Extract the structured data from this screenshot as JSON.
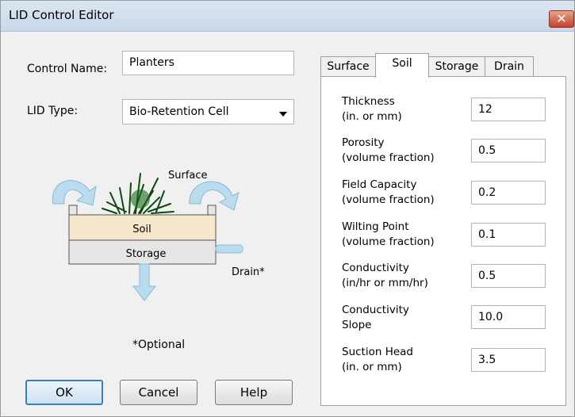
{
  "window": {
    "title": "LID Control Editor",
    "close_glyph": "✕"
  },
  "form": {
    "control_name_label": "Control Name:",
    "control_name_value": "Planters",
    "lid_type_label": "LID Type:",
    "lid_type_value": "Bio-Retention Cell"
  },
  "diagram": {
    "surface_label": "Surface",
    "soil_label": "Soil",
    "storage_label": "Storage",
    "drain_label": "Drain*",
    "optional_note": "*Optional"
  },
  "buttons": {
    "ok": "OK",
    "cancel": "Cancel",
    "help": "Help"
  },
  "tabs": [
    {
      "label": "Surface"
    },
    {
      "label": "Soil"
    },
    {
      "label": "Storage"
    },
    {
      "label": "Drain"
    }
  ],
  "active_tab": "Soil",
  "soil_params": [
    {
      "line1": "Thickness",
      "line2": "(in. or mm)",
      "value": "12"
    },
    {
      "line1": "Porosity",
      "line2": "(volume fraction)",
      "value": "0.5"
    },
    {
      "line1": "Field Capacity",
      "line2": "(volume fraction)",
      "value": "0.2"
    },
    {
      "line1": "Wilting Point",
      "line2": "(volume fraction)",
      "value": "0.1"
    },
    {
      "line1": "Conductivity",
      "line2": "(in/hr or mm/hr)",
      "value": "0.5"
    },
    {
      "line1": "Conductivity",
      "line2": "Slope",
      "value": "10.0"
    },
    {
      "line1": "Suction Head",
      "line2": "(in. or mm)",
      "value": "3.5"
    }
  ],
  "colors": {
    "soil": "#f5e6cc",
    "storage": "#e6e6e6",
    "arrow": "#b9dcef",
    "plant": "#1a6a1a",
    "titlebar": "#d4e0ef"
  }
}
